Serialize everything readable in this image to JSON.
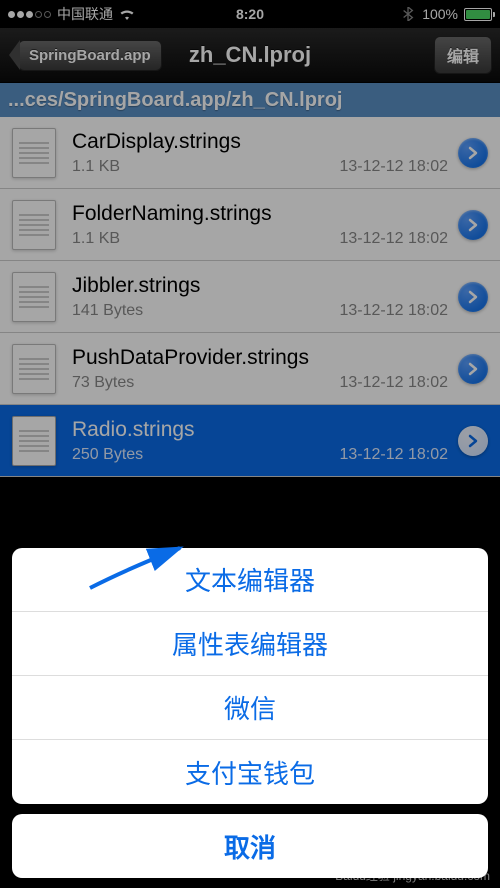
{
  "status": {
    "carrier": "中国联通",
    "time": "8:20",
    "battery_pct": "100%"
  },
  "nav": {
    "back_label": "SpringBoard.app",
    "title": "zh_CN.lproj",
    "edit_label": "编辑"
  },
  "path": "...ces/SpringBoard.app/zh_CN.lproj",
  "files": [
    {
      "name": "CarDisplay.strings",
      "size": "1.1 KB",
      "date": "13-12-12 18:02",
      "selected": false
    },
    {
      "name": "FolderNaming.strings",
      "size": "1.1 KB",
      "date": "13-12-12 18:02",
      "selected": false
    },
    {
      "name": "Jibbler.strings",
      "size": "141 Bytes",
      "date": "13-12-12 18:02",
      "selected": false
    },
    {
      "name": "PushDataProvider.strings",
      "size": "73 Bytes",
      "date": "13-12-12 18:02",
      "selected": false
    },
    {
      "name": "Radio.strings",
      "size": "250 Bytes",
      "date": "13-12-12 18:02",
      "selected": true
    }
  ],
  "action_sheet": {
    "options": [
      "文本编辑器",
      "属性表编辑器",
      "微信",
      "支付宝钱包"
    ],
    "cancel": "取消"
  },
  "watermark": "Baidu经验 jingyan.baidu.com"
}
